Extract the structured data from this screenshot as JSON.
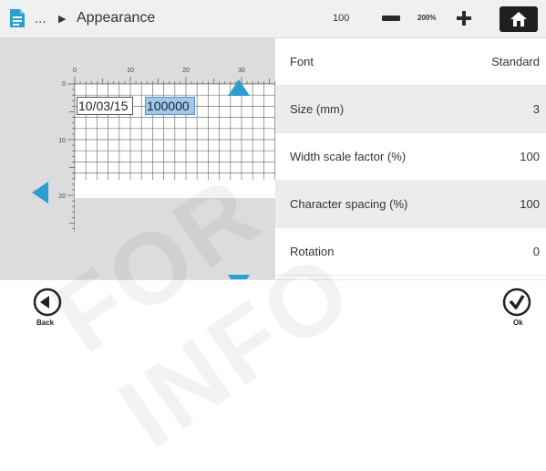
{
  "header": {
    "breadcrumb_ellipsis": "...",
    "title": "Appearance",
    "zoom_value": "100",
    "zoom_max_label": "200%"
  },
  "preview": {
    "ruler_top_ticks": [
      "0",
      "10",
      "20",
      "30"
    ],
    "ruler_left_ticks": [
      "0",
      "10",
      "20"
    ],
    "fields": {
      "date": "10/03/15",
      "number": "100000"
    }
  },
  "properties": [
    {
      "label": "Font",
      "value": "Standard"
    },
    {
      "label": "Size (mm)",
      "value": "3"
    },
    {
      "label": "Width scale factor (%)",
      "value": "100"
    },
    {
      "label": "Character spacing (%)",
      "value": "100"
    },
    {
      "label": "Rotation",
      "value": "0"
    }
  ],
  "footer": {
    "back_label": "Back",
    "ok_label": "Ok"
  },
  "watermark": "FOR INFO",
  "colors": {
    "accent_blue": "#2a9fd0",
    "selected_field": "#9ec8f0",
    "home_button": "#1f1f1f",
    "doc_icon": "#2a9fd0"
  },
  "icons": [
    "document-icon",
    "chevron-right-icon",
    "zoom-out-icon",
    "zoom-in-icon",
    "home-icon",
    "up-arrow-icon",
    "down-arrow-icon",
    "left-arrow-icon",
    "back-icon",
    "ok-check-icon"
  ]
}
